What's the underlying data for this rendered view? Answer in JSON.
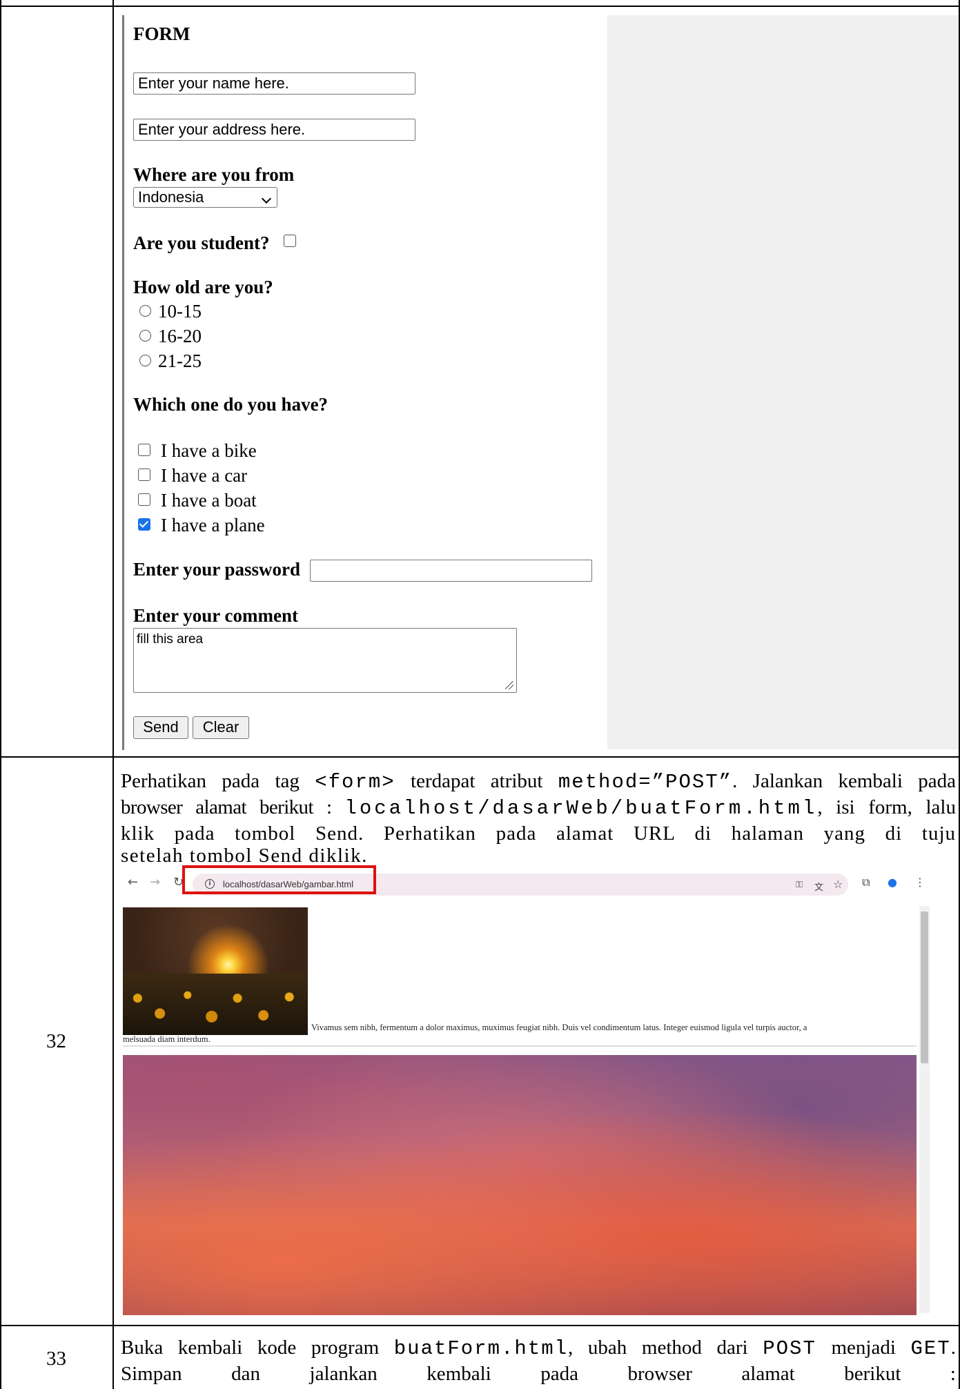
{
  "form": {
    "title": "FORM",
    "name_value": "Enter your name here.",
    "address_value": "Enter your address here.",
    "country_label": "Where are you from",
    "country_selected": "Indonesia",
    "student_label": "Are you student?",
    "age_label": "How old are you?",
    "age_options": [
      "10-15",
      "16-20",
      "21-25"
    ],
    "vehicle_label": "Which one do you have?",
    "vehicles": [
      "I have a bike",
      "I have a car",
      "I have a boat",
      "I have a plane"
    ],
    "vehicles_checked": [
      false,
      false,
      false,
      true
    ],
    "password_label": "Enter your password",
    "comment_label": "Enter your comment",
    "comment_value": "fill this area",
    "send_label": "Send",
    "clear_label": "Clear"
  },
  "rows": [
    {
      "number": "32",
      "p1": "Perhatikan pada tag ",
      "p1_code1": "<form>",
      "p1_mid": " terdapat atribut ",
      "p1_code2": "method=”POST”",
      "p1_end": ". Jalankan kembali pada",
      "p2_start": "browser alamat berikut : ",
      "p2_code": "localhost/dasarWeb/buatForm.html",
      "p2_end": ", isi form, lalu",
      "p3": "klik pada tombol Send. Perhatikan pada alamat URL di halaman yang di tuju",
      "p4": "setelah tombol Send diklik."
    },
    {
      "number": "33",
      "p1_start": "Buka kembali kode program ",
      "p1_code1": "buatForm.html",
      "p1_mid": ", ubah method dari ",
      "p1_code2": "POST",
      "p1_mid2": " menjadi ",
      "p1_code3": "GET",
      "p1_end": ".",
      "p2_words": [
        "Simpan",
        "dan",
        "jalankan",
        "kembali",
        "pada",
        "browser",
        "alamat",
        "berikut",
        ":"
      ]
    }
  ],
  "browser": {
    "url": "localhost/dasarWeb/gambar.html",
    "caption_line1": "Vivamus sem nibh, fermentum a dolor maximus, muximus feugiat nibh. Duis vel condimentum latus. Integer euismod ligula vel turpis auctor, a",
    "caption_line2": "melsuada diam interdum.",
    "highlight_color": "#e01010"
  }
}
